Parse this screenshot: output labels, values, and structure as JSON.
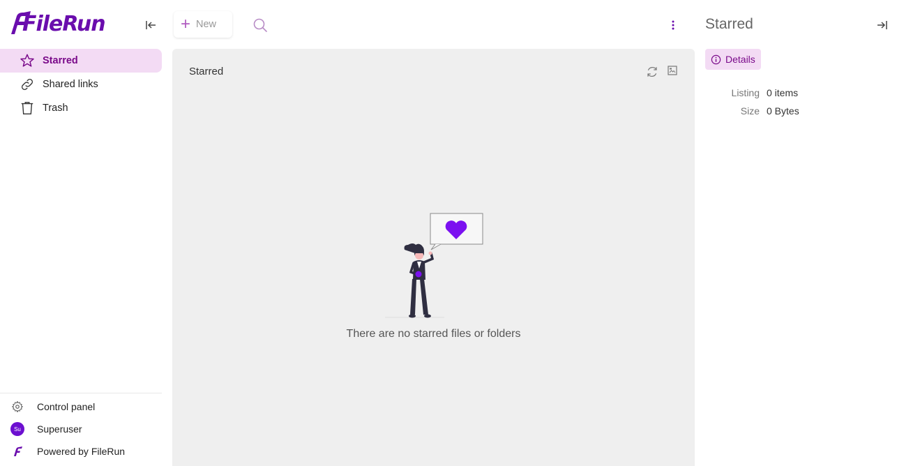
{
  "brand": {
    "logo_text": "FileRun",
    "accent": "#6a0dad",
    "highlight_bg": "#f3dbf4"
  },
  "sidebar": {
    "items": [
      {
        "label": "Starred",
        "icon": "star-icon",
        "active": true
      },
      {
        "label": "Shared links",
        "icon": "link-icon",
        "active": false
      },
      {
        "label": "Trash",
        "icon": "trash-icon",
        "active": false
      }
    ],
    "bottom": [
      {
        "label": "Control panel",
        "icon": "gear-icon"
      },
      {
        "label": "Superuser",
        "icon": "avatar",
        "avatar_text": "Su"
      },
      {
        "label": "Powered by FileRun",
        "icon": "filerun-logo-icon"
      }
    ]
  },
  "toolbar": {
    "new_label": "New"
  },
  "main": {
    "title": "Starred",
    "empty_message": "There are no starred files or folders"
  },
  "details_panel": {
    "title": "Starred",
    "tab_label": "Details",
    "rows": [
      {
        "key": "Listing",
        "value": "0 items"
      },
      {
        "key": "Size",
        "value": "0 Bytes"
      }
    ]
  }
}
